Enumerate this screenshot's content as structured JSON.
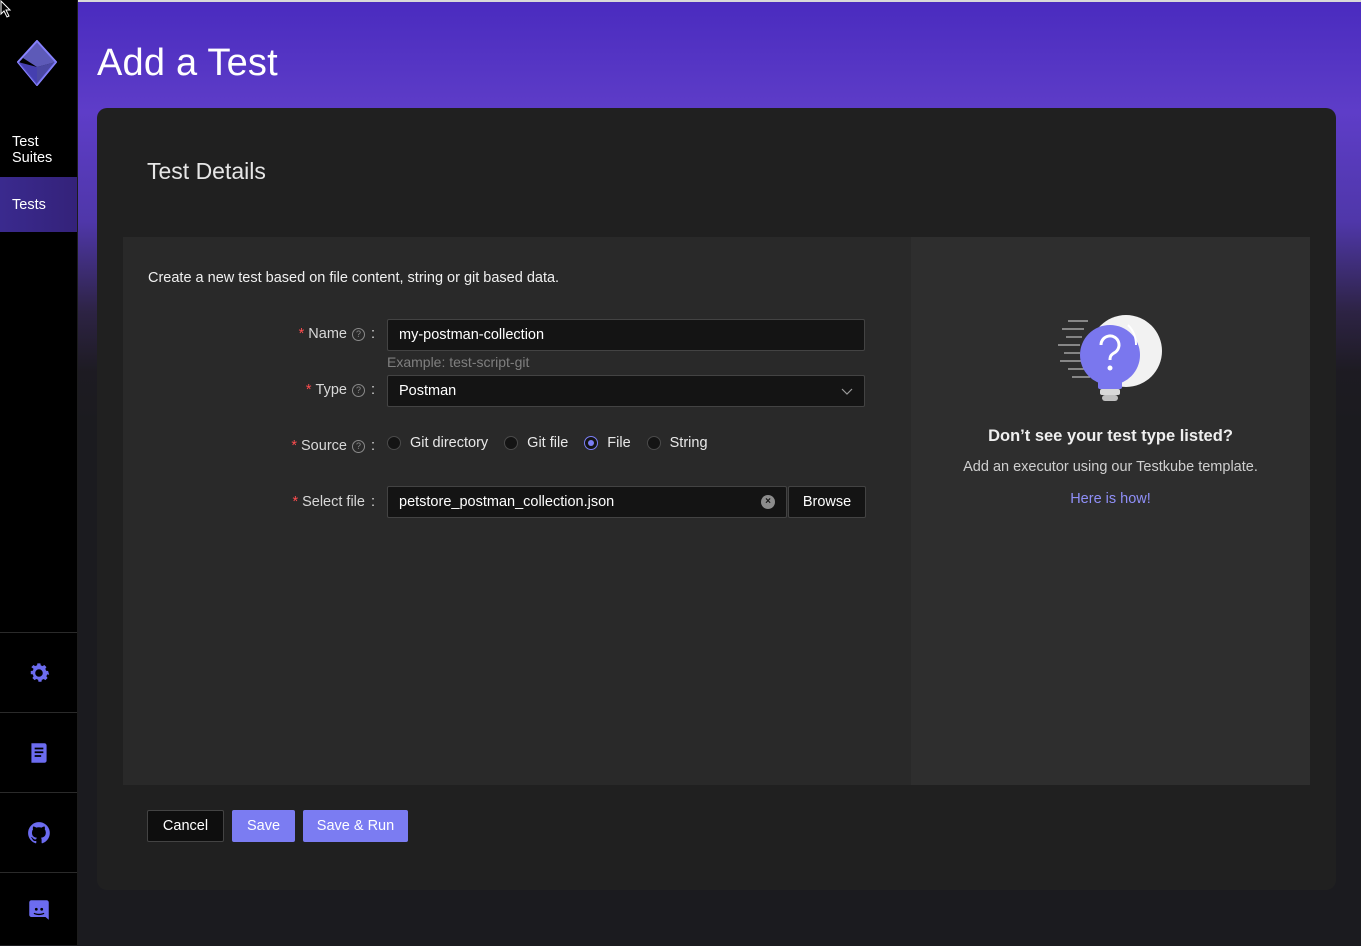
{
  "page": {
    "title": "Add a Test"
  },
  "sidebar": {
    "items": [
      {
        "label": "Test\nSuites",
        "active": false
      },
      {
        "label": "Tests",
        "active": true
      }
    ],
    "bottom_icons": [
      "settings-icon",
      "documentation-icon",
      "github-icon",
      "discord-icon"
    ],
    "accent_color": "#6c6cf0"
  },
  "card": {
    "title": "Test Details",
    "intro": "Create a new test based on file content, string or git based data.",
    "form": {
      "name": {
        "label": "Name",
        "value": "my-postman-collection",
        "hint": "Example: test-script-git"
      },
      "type": {
        "label": "Type",
        "value": "Postman"
      },
      "source": {
        "label": "Source",
        "options": [
          "Git directory",
          "Git file",
          "File",
          "String"
        ],
        "selected": "File"
      },
      "select_file": {
        "label": "Select file",
        "value": "petstore_postman_collection.json",
        "browse_label": "Browse"
      }
    },
    "help": {
      "title": "Don’t see your test type listed?",
      "text": "Add an executor using our Testkube template.",
      "link": "Here is how!"
    },
    "actions": {
      "cancel": "Cancel",
      "save": "Save",
      "save_run": "Save & Run"
    }
  },
  "colors": {
    "primary": "#7b7cf2",
    "required": "#ff4d4f",
    "link": "#8f8ff7"
  }
}
